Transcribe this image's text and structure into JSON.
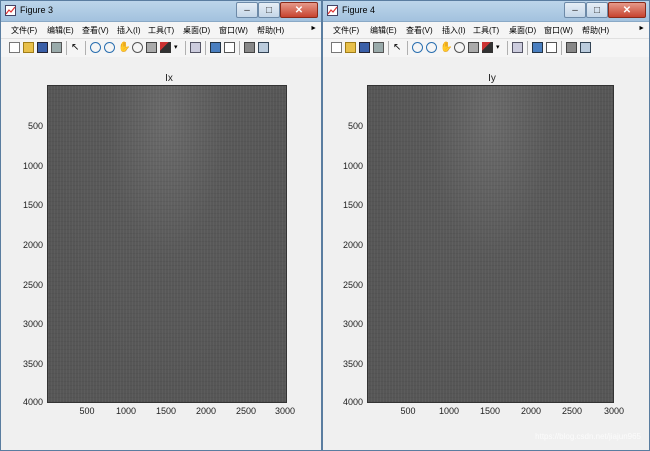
{
  "menu": [
    "文件(F)",
    "编辑(E)",
    "查看(V)",
    "插入(I)",
    "工具(T)",
    "桌面(D)",
    "窗口(W)",
    "帮助(H)"
  ],
  "colors": {
    "titlebar": "#a3c2de",
    "close_button": "#c7432f",
    "image_gray": "#565656"
  },
  "figures": [
    {
      "window_title": "Figure 3",
      "chart_data": {
        "type": "image",
        "title": "Ix",
        "xlabel": "",
        "ylabel": "",
        "xlim": [
          0,
          3000
        ],
        "ylim": [
          0,
          4000
        ],
        "x_ticks": [
          "500",
          "1000",
          "1500",
          "2000",
          "2500",
          "3000"
        ],
        "y_ticks": [
          "500",
          "1000",
          "1500",
          "2000",
          "2500",
          "3000",
          "3500",
          "4000"
        ],
        "y_reversed": true,
        "colormap": "gray"
      }
    },
    {
      "window_title": "Figure 4",
      "chart_data": {
        "type": "image",
        "title": "Iy",
        "xlabel": "",
        "ylabel": "",
        "xlim": [
          0,
          3000
        ],
        "ylim": [
          0,
          4000
        ],
        "x_ticks": [
          "500",
          "1000",
          "1500",
          "2000",
          "2500",
          "3000"
        ],
        "y_ticks": [
          "500",
          "1000",
          "1500",
          "2000",
          "2500",
          "3000",
          "3500",
          "4000"
        ],
        "y_reversed": true,
        "colormap": "gray"
      }
    }
  ],
  "watermark": "https://blog.csdn.net/jiajun965"
}
